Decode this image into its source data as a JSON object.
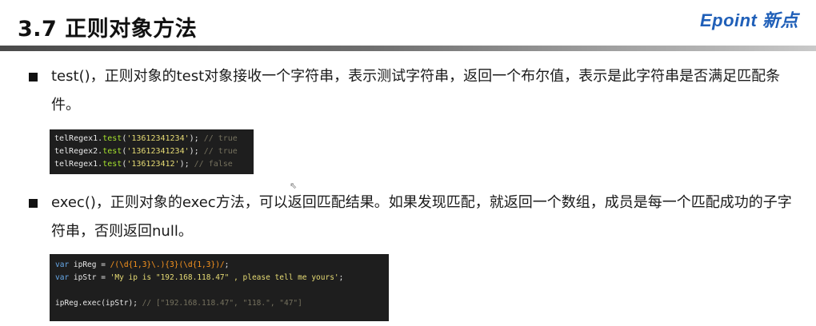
{
  "title": "3.7 正则对象方法",
  "logo": "Epoint 新点",
  "bullets": [
    {
      "text": "test()，正则对象的test对象接收一个字符串，表示测试字符串，返回一个布尔值，表示是此字符串是否满足匹配条件。"
    },
    {
      "text": "exec()，正则对象的exec方法，可以返回匹配结果。如果发现匹配，就返回一个数组，成员是每一个匹配成功的子字符串，否则返回null。"
    }
  ],
  "code1": [
    {
      "obj": "telRegex1.",
      "fn": "test",
      "open": "(",
      "arg": "'13612341234'",
      "close": "); ",
      "comment": "// true"
    },
    {
      "obj": "telRegex2.",
      "fn": "test",
      "open": "(",
      "arg": "'13612341234'",
      "close": "); ",
      "comment": "// true"
    },
    {
      "obj": "telRegex1.",
      "fn": "test",
      "open": "(",
      "arg": "'136123412'",
      "close": "); ",
      "comment": "// false"
    }
  ],
  "code2": {
    "line1": {
      "kw": "var",
      "name": " ipReg = ",
      "regex": "/(\\d{1,3}\\.){3}(\\d{1,3})/",
      "end": ";"
    },
    "line2": {
      "kw": "var",
      "name": " ipStr = ",
      "str": "'My ip is \"192.168.118.47\" , please tell me yours'",
      "end": ";"
    },
    "line3": {
      "code": "ipReg.exec(ipStr); ",
      "comment": "// [\"192.168.118.47\", \"118.\", \"47\"]"
    }
  }
}
